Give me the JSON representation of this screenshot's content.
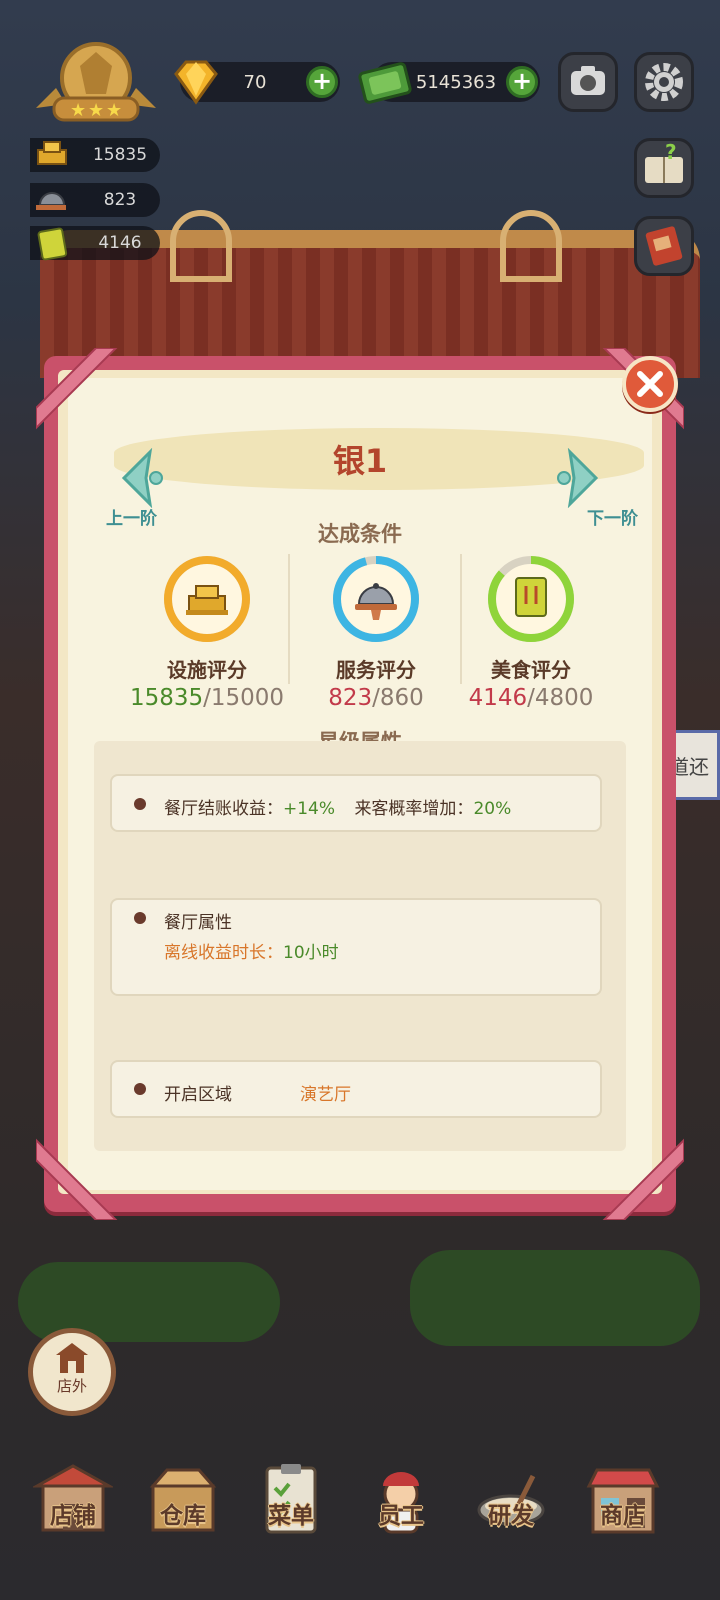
{
  "hud": {
    "gems": "70",
    "cash": "5145363",
    "facility_score": "15835",
    "service_score": "823",
    "food_score": "4146"
  },
  "panel": {
    "title": "银1",
    "prev_label": "上一阶",
    "next_label": "下一阶",
    "conditions_label": "达成条件",
    "stats": [
      {
        "name": "设施评分",
        "current": "15835",
        "target": "/15000",
        "progress": 1.0,
        "ring_color": "#f2ab2b"
      },
      {
        "name": "服务评分",
        "current": "823",
        "target": "/860",
        "progress": 0.957,
        "ring_color": "#3db5e3"
      },
      {
        "name": "美食评分",
        "current": "4146",
        "target": "/4800",
        "progress": 0.864,
        "ring_color": "#8fd43a"
      }
    ],
    "star_attr_label": "星级属性",
    "attributes": {
      "revenue_label": "餐厅结账收益：",
      "revenue_value": "+14%",
      "guest_label": "来客概率增加：",
      "guest_value": "20%",
      "restaurant_attr_label": "餐厅属性",
      "offline_label": "离线收益时长：",
      "offline_value": "10小时",
      "unlock_label": "开启区域",
      "unlock_value": "演艺厅"
    }
  },
  "outside_button": "店外",
  "signboard_text": "道还",
  "bottom_tabs": [
    "店铺",
    "仓库",
    "菜单",
    "员工",
    "研发",
    "商店"
  ]
}
